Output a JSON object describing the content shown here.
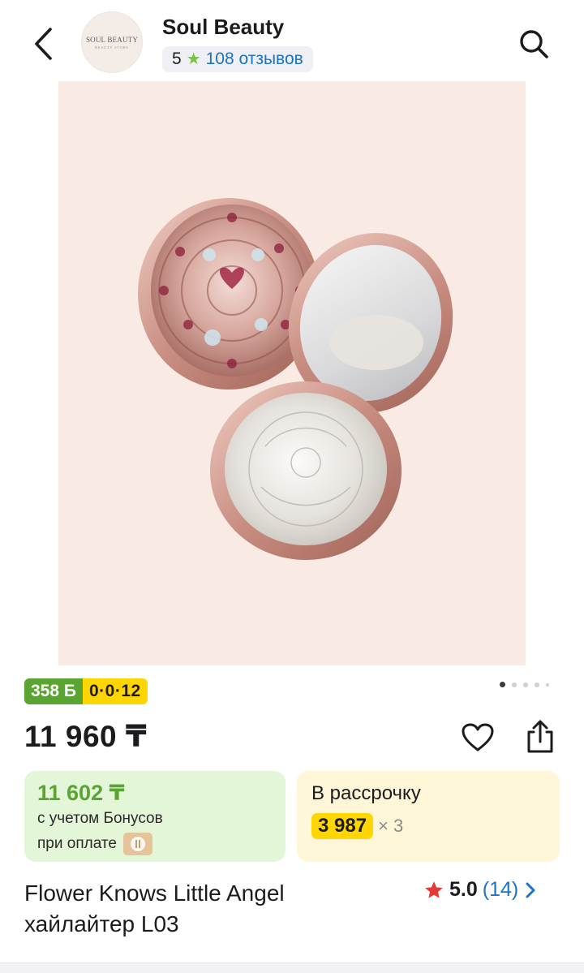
{
  "header": {
    "logo_text": "SOUL BEAUTY",
    "logo_subtext": "BEAUTY STORE",
    "store_name": "Soul Beauty",
    "rating": "5",
    "reviews_text": "108 отзывов"
  },
  "product": {
    "image_description_icon": "product-photo",
    "bonus_badge": "358 Б",
    "installment_badge": "0·0·12",
    "price": "11 960 ₸",
    "bonus_card": {
      "amount": "11 602 ₸",
      "line1": "с учетом Бонусов",
      "line2": "при оплате"
    },
    "installment_card": {
      "label": "В рассрочку",
      "amount": "3 987",
      "multiplier": "× 3"
    },
    "title": "Flower Knows Little Angel хайлайтер L03",
    "rating_value": "5.0",
    "rating_count": "(14)"
  },
  "colors": {
    "bonus_green": "#5aa531",
    "installment_yellow": "#ffd600",
    "link_blue": "#1a73c7",
    "star_red": "#e53935",
    "image_bg": "#f9ebe3"
  }
}
